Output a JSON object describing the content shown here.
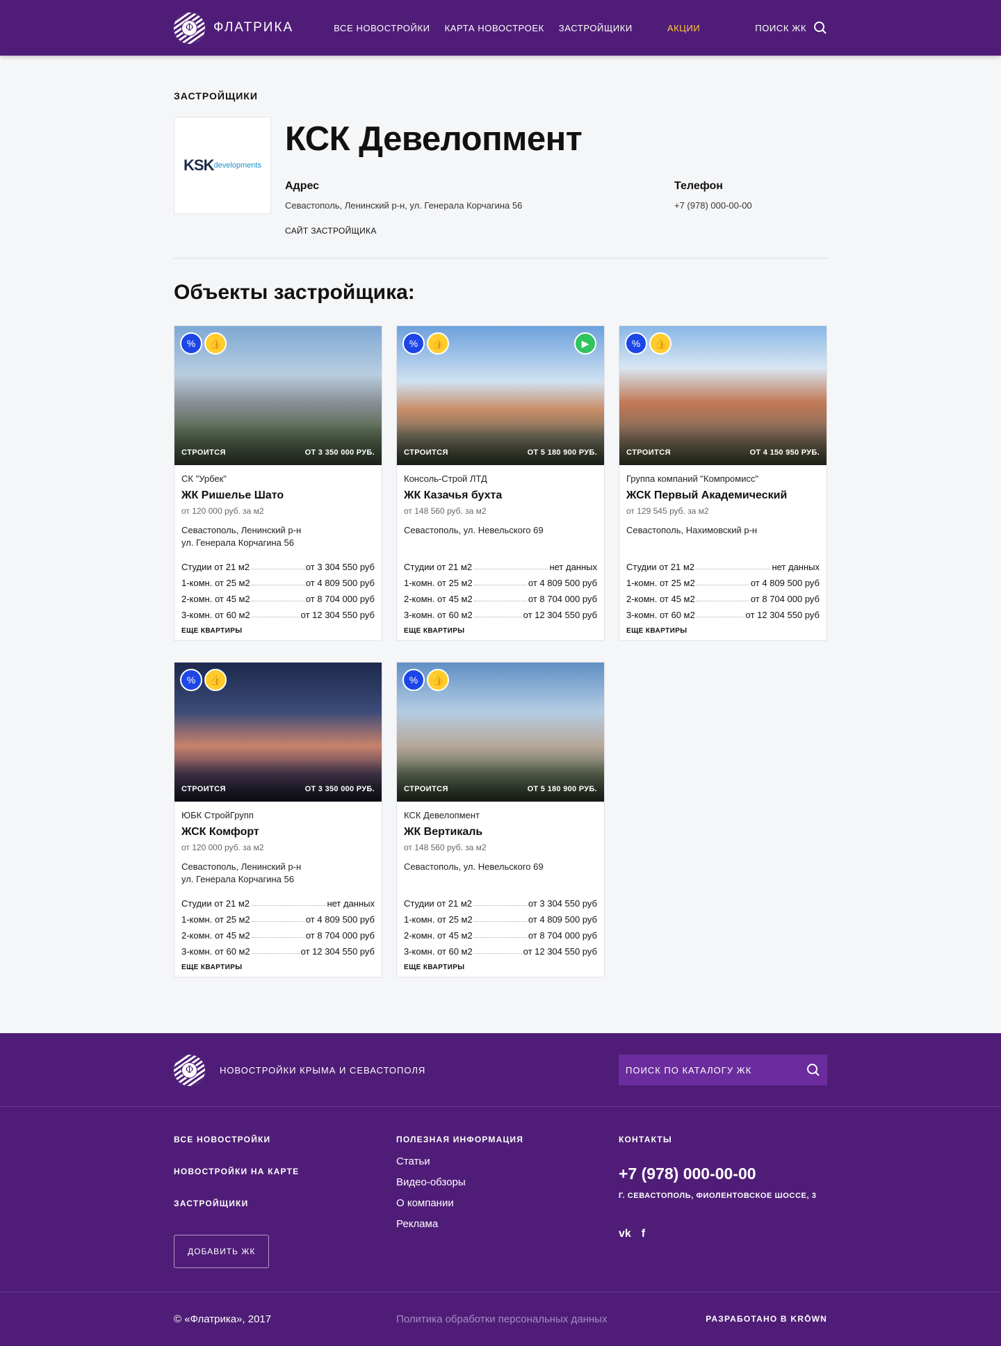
{
  "header": {
    "logo_text": "ФЛАТРИКА",
    "logo_letter": "Ф",
    "nav": [
      "ВСЕ НОВОСТРОЙКИ",
      "КАРТА НОВОСТРОЕК",
      "ЗАСТРОЙЩИКИ"
    ],
    "promo": "АКЦИИ",
    "search_label": "ПОИСК ЖК",
    "accent_color": "#4f1d77",
    "promo_color": "#ffc93c"
  },
  "developer": {
    "breadcrumb": "ЗАСТРОЙЩИКИ",
    "name": "КСК Девелопмент",
    "logo_main": "KSK",
    "logo_sub": "developments",
    "address_label": "Адрес",
    "address": "Севастополь, Ленинский р-н, ул. Генерала Корчагина 56",
    "phone_label": "Телефон",
    "phone": "+7 (978) 000-00-00",
    "site_link": "САЙТ ЗАСТРОЙЩИКА"
  },
  "objects_title": "Объекты застройщика:",
  "cards": [
    {
      "status": "СТРОИТСЯ",
      "price": "ОТ 3 350 000 РУБ.",
      "developer": "СК \"Урбек\"",
      "name": "ЖК Ришелье Шато",
      "sqm": "от 120 000 руб. за м2",
      "address_1": "Севастополь, Ленинский р-н",
      "address_2": "ул. Генерала Корчагина 56",
      "rows": [
        {
          "type": "Студии от 21 м2",
          "price": "от 3 304 550 руб"
        },
        {
          "type": "1-комн. от 25 м2",
          "price": "от 4 809 500 руб"
        },
        {
          "type": "2-комн. от 45 м2",
          "price": "от 8 704 000 руб"
        },
        {
          "type": "3-комн. от 60 м2",
          "price": "от 12 304 550 руб"
        }
      ],
      "more": "ЕЩЕ КВАРТИРЫ",
      "video": false
    },
    {
      "status": "СТРОИТСЯ",
      "price": "ОТ 5 180 900 РУБ.",
      "developer": "Консоль-Строй ЛТД",
      "name": "ЖК Казачья бухта",
      "sqm": "от 148 560 руб. за м2",
      "address_1": "Севастополь, ул. Невельского 69",
      "address_2": "",
      "rows": [
        {
          "type": "Студии от 21 м2",
          "price": "нет данных"
        },
        {
          "type": "1-комн. от 25 м2",
          "price": "от 4 809 500 руб"
        },
        {
          "type": "2-комн. от 45 м2",
          "price": "от 8 704 000 руб"
        },
        {
          "type": "3-комн. от 60 м2",
          "price": "от 12 304 550 руб"
        }
      ],
      "more": "ЕЩЕ КВАРТИРЫ",
      "video": true
    },
    {
      "status": "СТРОИТСЯ",
      "price": "ОТ 4 150 950 РУБ.",
      "developer": "Группа компаний \"Компромисс\"",
      "name": "ЖСК Первый Академический",
      "sqm": "от 129 545 руб. за м2",
      "address_1": "Севастополь, Нахимовский р-н",
      "address_2": "",
      "rows": [
        {
          "type": "Студии от 21 м2",
          "price": "нет данных"
        },
        {
          "type": "1-комн. от 25 м2",
          "price": "от 4 809 500 руб"
        },
        {
          "type": "2-комн. от 45 м2",
          "price": "от 8 704 000 руб"
        },
        {
          "type": "3-комн. от 60 м2",
          "price": "от 12 304 550 руб"
        }
      ],
      "more": "ЕЩЕ КВАРТИРЫ",
      "video": false
    },
    {
      "status": "СТРОИТСЯ",
      "price": "ОТ 3 350 000 РУБ.",
      "developer": "ЮБК СтройГрупп",
      "name": "ЖСК Комфорт",
      "sqm": "от 120 000 руб. за м2",
      "address_1": "Севастополь, Ленинский р-н",
      "address_2": "ул. Генерала Корчагина 56",
      "rows": [
        {
          "type": "Студии от 21 м2",
          "price": "нет данных"
        },
        {
          "type": "1-комн. от 25 м2",
          "price": "от 4 809 500 руб"
        },
        {
          "type": "2-комн. от 45 м2",
          "price": "от 8 704 000 руб"
        },
        {
          "type": "3-комн. от 60 м2",
          "price": "от 12 304 550 руб"
        }
      ],
      "more": "ЕЩЕ КВАРТИРЫ",
      "video": false
    },
    {
      "status": "СТРОИТСЯ",
      "price": "ОТ 5 180 900 РУБ.",
      "developer": "КСК Девелопмент",
      "name": "ЖК Вертикаль",
      "sqm": "от 148 560 руб. за м2",
      "address_1": "Севастополь, ул. Невельского 69",
      "address_2": "",
      "rows": [
        {
          "type": "Студии от 21 м2",
          "price": "от 3 304 550 руб"
        },
        {
          "type": "1-комн. от 25 м2",
          "price": "от 4 809 500 руб"
        },
        {
          "type": "2-комн. от 45 м2",
          "price": "от 8 704 000 руб"
        },
        {
          "type": "3-комн. от 60 м2",
          "price": "от 12 304 550 руб"
        }
      ],
      "more": "ЕЩЕ КВАРТИРЫ",
      "video": false
    }
  ],
  "footer": {
    "tagline": "НОВОСТРОЙКИ КРЫМА И СЕВАСТОПОЛЯ",
    "search_placeholder": "ПОИСК ПО КАТАЛОГУ ЖК",
    "col1": [
      "ВСЕ НОВОСТРОЙКИ",
      "НОВОСТРОЙКИ НА КАРТЕ",
      "ЗАСТРОЙЩИКИ"
    ],
    "add_button": "ДОБАВИТЬ ЖК",
    "col2_heading": "ПОЛЕЗНАЯ ИНФОРМАЦИЯ",
    "col2_links": [
      "Статьи",
      "Видео-обзоры",
      "О компании",
      "Реклама"
    ],
    "col3_heading": "КОНТАКТЫ",
    "phone": "+7 (978) 000-00-00",
    "address": "Г. СЕВАСТОПОЛЬ, ФИОЛЕНТОВСКОЕ ШОССЕ, 3",
    "social_vk": "vk",
    "social_fb": "f",
    "copyright": "© «Флатрика», 2017",
    "policy": "Политика обработки персональных данных",
    "developed_by": "РАЗРАБОТАНО В KRŌWN"
  }
}
